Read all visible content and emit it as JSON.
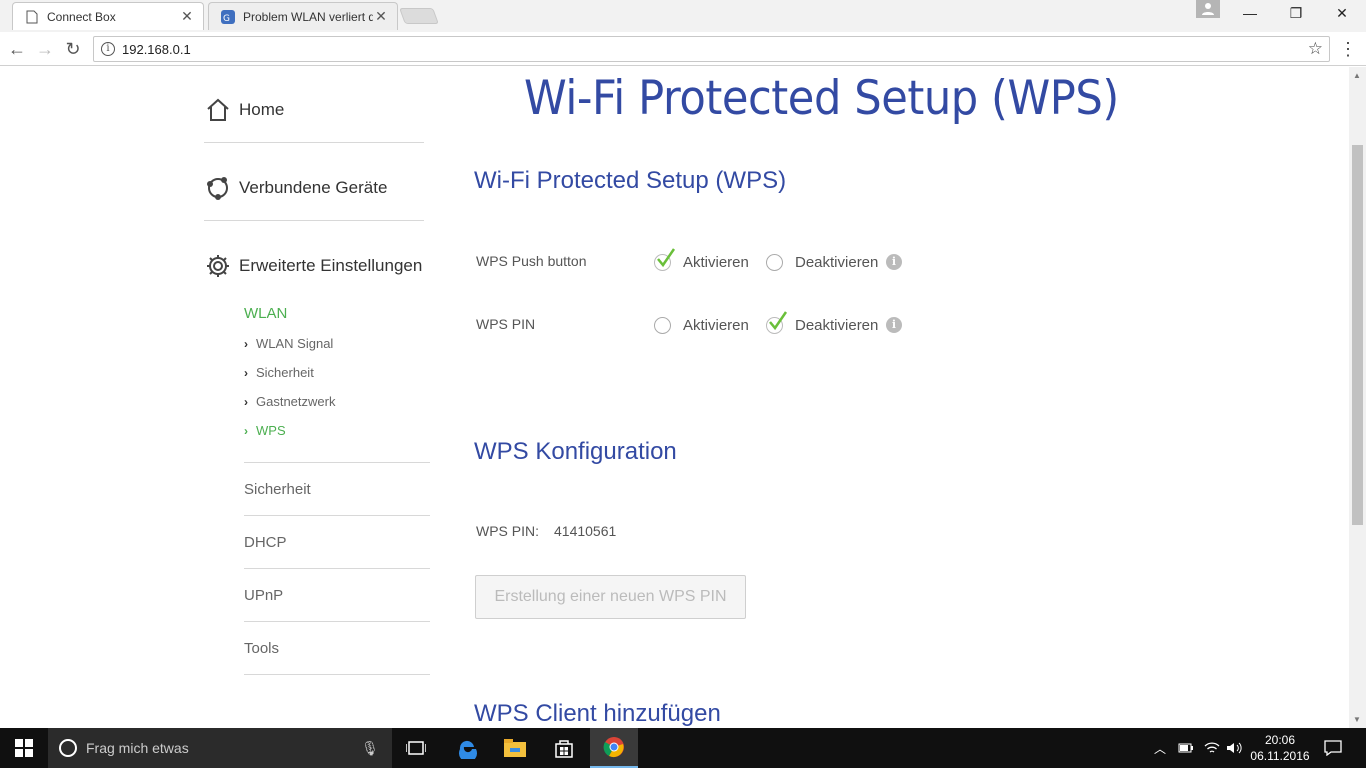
{
  "browser": {
    "tabs": [
      {
        "title": "Connect Box",
        "active": true
      },
      {
        "title": "Problem WLAN verliert d",
        "active": false
      }
    ],
    "url": "192.168.0.1"
  },
  "sidebar": {
    "main": [
      {
        "label": "Home",
        "icon": "home-icon"
      },
      {
        "label": "Verbundene Geräte",
        "icon": "devices-icon"
      },
      {
        "label": "Erweiterte Einstellungen",
        "icon": "gear-icon"
      }
    ],
    "wlan_heading": "WLAN",
    "wlan_items": [
      "WLAN Signal",
      "Sicherheit",
      "Gastnetzwerk",
      "WPS"
    ],
    "sections": [
      "Sicherheit",
      "DHCP",
      "UPnP",
      "Tools"
    ]
  },
  "main": {
    "page_title": "Wi-Fi Protected Setup (WPS)",
    "section1_title": "Wi-Fi Protected Setup (WPS)",
    "push_label": "WPS Push button",
    "pin_row_label": "WPS PIN",
    "activate": "Aktivieren",
    "deactivate": "Deaktivieren",
    "push_selected": "Aktivieren",
    "pin_selected": "Deaktivieren",
    "section2_title": "WPS Konfiguration",
    "pin_label": "WPS PIN:",
    "pin_value": "41410561",
    "new_pin_button": "Erstellung einer neuen WPS PIN",
    "section3_title": "WPS Client hinzufügen"
  },
  "taskbar": {
    "search_placeholder": "Frag mich etwas",
    "time": "20:06",
    "date": "06.11.2016"
  },
  "colors": {
    "accent_blue": "#334aa3",
    "accent_green": "#4caf50"
  }
}
